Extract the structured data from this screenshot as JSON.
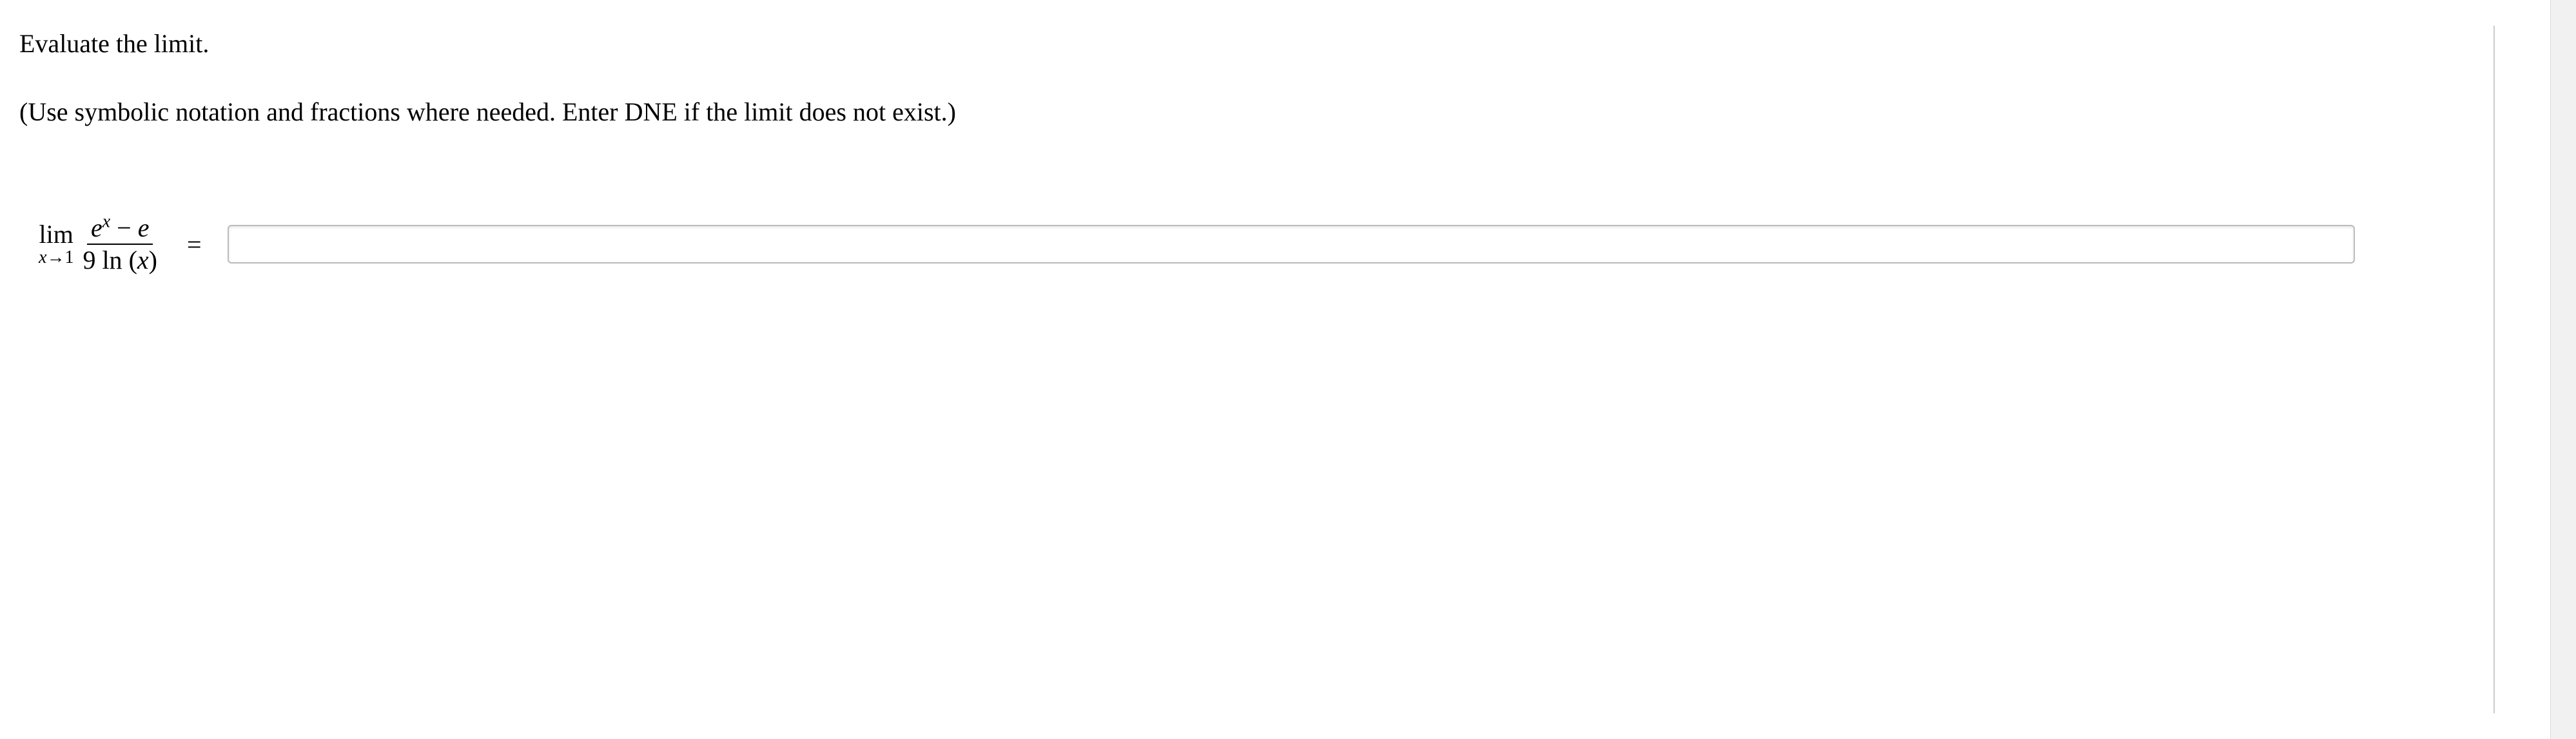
{
  "instruction": "Evaluate the limit.",
  "hint": "(Use symbolic notation and fractions where needed. Enter DNE if the limit does not exist.)",
  "limit": {
    "operator": "lim",
    "approach_var": "x",
    "approach_arrow": "→",
    "approach_value": "1",
    "numerator": {
      "base1": "e",
      "exp1": "x",
      "minus": " − ",
      "term2": "e"
    },
    "denominator": {
      "coef": "9",
      "func": " ln ",
      "open": "(",
      "var": "x",
      "close": ")"
    }
  },
  "equals": "=",
  "answer_value": ""
}
